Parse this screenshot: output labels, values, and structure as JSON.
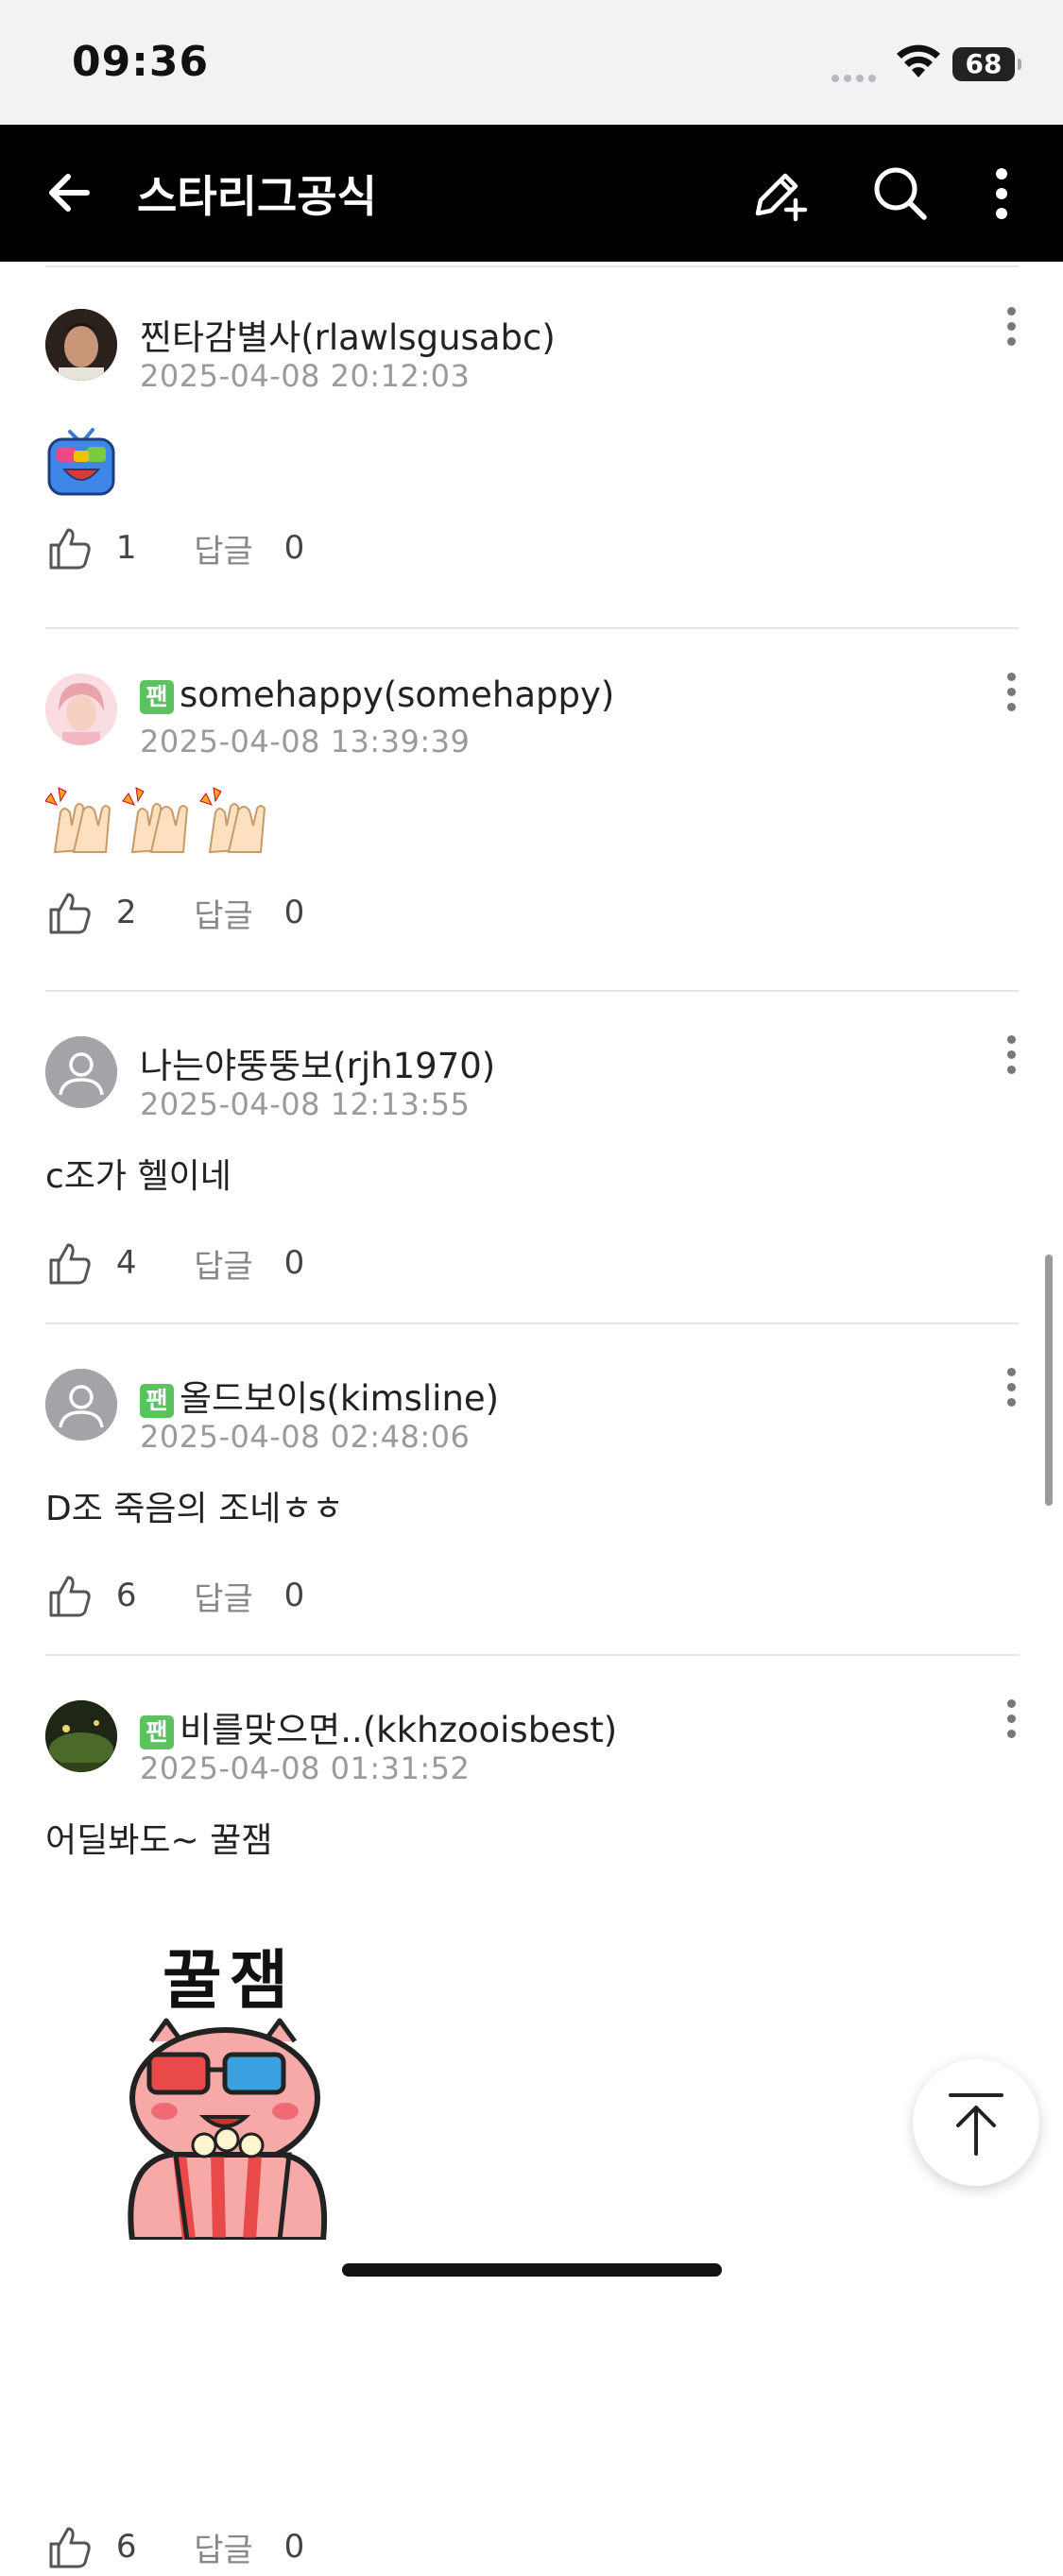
{
  "status_bar": {
    "time": "09:36",
    "battery": "68"
  },
  "header": {
    "title": "스타리그공식",
    "back_icon": "arrow-left-icon",
    "write_icon": "pencil-plus-icon",
    "search_icon": "search-icon",
    "more_icon": "kebab-menu-icon"
  },
  "comments": [
    {
      "author": "찐타감별사(rlawlsgusabc)",
      "fan": false,
      "date": "2025-04-08 20:12:03",
      "text": "",
      "sticker": "tv-robot-emoji",
      "likes": "1",
      "reply_label": "답글",
      "replies": "0"
    },
    {
      "author": "somehappy(somehappy)",
      "fan": true,
      "fan_badge": "팬",
      "date": "2025-04-08 13:39:39",
      "text": "",
      "sticker": "clapping-hands-emoji",
      "likes": "2",
      "reply_label": "답글",
      "replies": "0"
    },
    {
      "author": "나는야뚱뚱보(rjh1970)",
      "fan": false,
      "date": "2025-04-08 12:13:55",
      "text": "c조가 헬이네",
      "likes": "4",
      "reply_label": "답글",
      "replies": "0"
    },
    {
      "author": "올드보이s(kimsline)",
      "fan": true,
      "fan_badge": "팬",
      "date": "2025-04-08 02:48:06",
      "text": "D조 죽음의 조네ㅎㅎ",
      "likes": "6",
      "reply_label": "답글",
      "replies": "0"
    },
    {
      "author": "비를맞으면..(kkhzooisbest)",
      "fan": true,
      "fan_badge": "팬",
      "date": "2025-04-08 01:31:52",
      "text": "어딜봐도~ 꿀잼",
      "sticker": "pink-character-popcorn-sticker",
      "sticker_caption": "꿀잼",
      "likes": "6",
      "reply_label": "답글",
      "replies": "0"
    }
  ],
  "scroll_top_icon": "arrow-up-to-top-icon"
}
